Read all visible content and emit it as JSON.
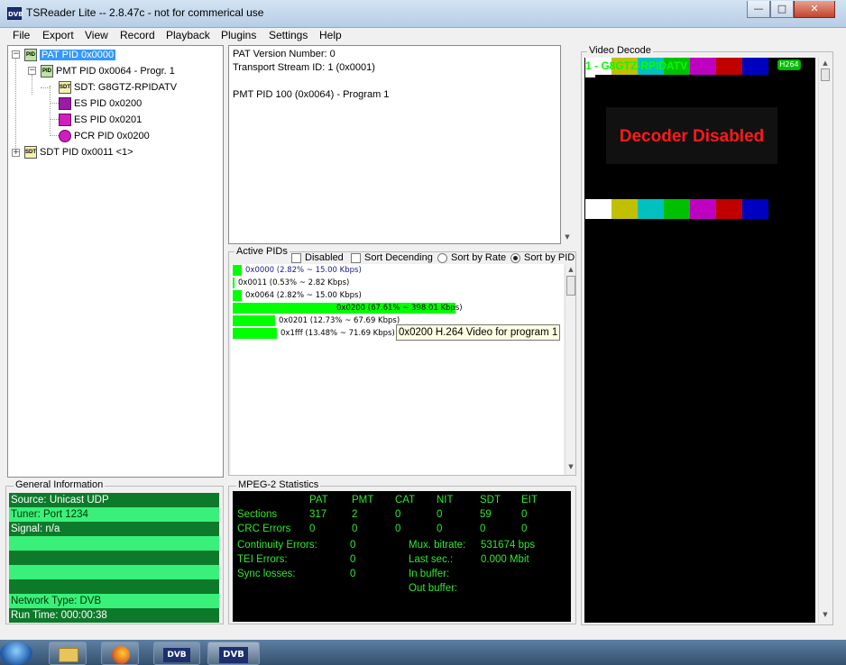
{
  "window": {
    "title": "TSReader Lite -- 2.8.47c - not for commerical use",
    "app_icon_text": "DVB"
  },
  "menu": [
    "File",
    "Export",
    "View",
    "Record",
    "Playback",
    "Plugins",
    "Settings",
    "Help"
  ],
  "tree": {
    "pat": "PAT PID 0x0000",
    "pmt": "PMT PID 0x0064 - Progr. 1",
    "sdt_child": "SDT: G8GTZ-RPIDATV",
    "es1": "ES PID 0x0200",
    "es2": "ES PID 0x0201",
    "pcr": "PCR PID 0x0200",
    "sdt": "SDT PID 0x0011 <1>"
  },
  "info": {
    "line1": "PAT Version Number: 0",
    "line2": "Transport Stream ID: 1 (0x0001)",
    "line3": "PMT PID 100 (0x0064) - Program 1"
  },
  "active_pids": {
    "title": "Active PIDs",
    "disabled_label": "Disabled",
    "sort_desc_label": "Sort Decending",
    "sort_rate_label": "Sort by Rate",
    "sort_pid_label": "Sort by PID",
    "rows": [
      {
        "label": "0x0000 (2.82% ~ 15.00 Kbps)",
        "percent": 2.82
      },
      {
        "label": "0x0011 (0.53% ~ 2.82 Kbps)",
        "percent": 0.53
      },
      {
        "label": "0x0064 (2.82% ~ 15.00 Kbps)",
        "percent": 2.82
      },
      {
        "label": "0x0200 (67.61% ~ 398.01 Kbps)",
        "percent": 67.61
      },
      {
        "label": "0x0201 (12.73% ~ 67.69 Kbps)",
        "percent": 12.73
      },
      {
        "label": "0x1fff (13.48% ~ 71.69 Kbps)",
        "percent": 13.48
      }
    ],
    "tooltip": "0x0200 H.264 Video for program 1"
  },
  "general_info": {
    "title": "General Information",
    "rows": [
      "Source: Unicast UDP",
      "Tuner: Port 1234",
      "Signal: n/a",
      "",
      "",
      "",
      "",
      "Network Type: DVB",
      "Run Time: 000:00:38"
    ]
  },
  "mpeg2": {
    "title": "MPEG-2 Statistics",
    "headers": [
      "PAT",
      "PMT",
      "CAT",
      "NIT",
      "SDT",
      "EIT"
    ],
    "sections_label": "Sections",
    "sections": [
      "317",
      "2",
      "0",
      "0",
      "59",
      "0"
    ],
    "crc_label": "CRC Errors",
    "crc": [
      "0",
      "0",
      "0",
      "0",
      "0",
      "0"
    ],
    "continuity_label": "Continuity Errors:",
    "continuity": "0",
    "tei_label": "TEI Errors:",
    "tei": "0",
    "sync_label": "Sync losses:",
    "sync": "0",
    "mux_label": "Mux. bitrate:",
    "mux": "531674 bps",
    "last_label": "Last sec.:",
    "last": "0.000 Mbit",
    "inbuf_label": "In buffer:",
    "outbuf_label": "Out buffer:"
  },
  "video": {
    "title": "Video Decode",
    "service": "1 - G8GTZ-RPIDATV",
    "codec": "H264",
    "disabled_text": "Decoder Disabled",
    "bar_colors": [
      "#ffffff",
      "#c0c000",
      "#00c0c0",
      "#00c000",
      "#c000c0",
      "#c00000",
      "#0000c0"
    ]
  },
  "taskbar": {
    "dvb1": "DVB",
    "dvb2": "DVB"
  }
}
